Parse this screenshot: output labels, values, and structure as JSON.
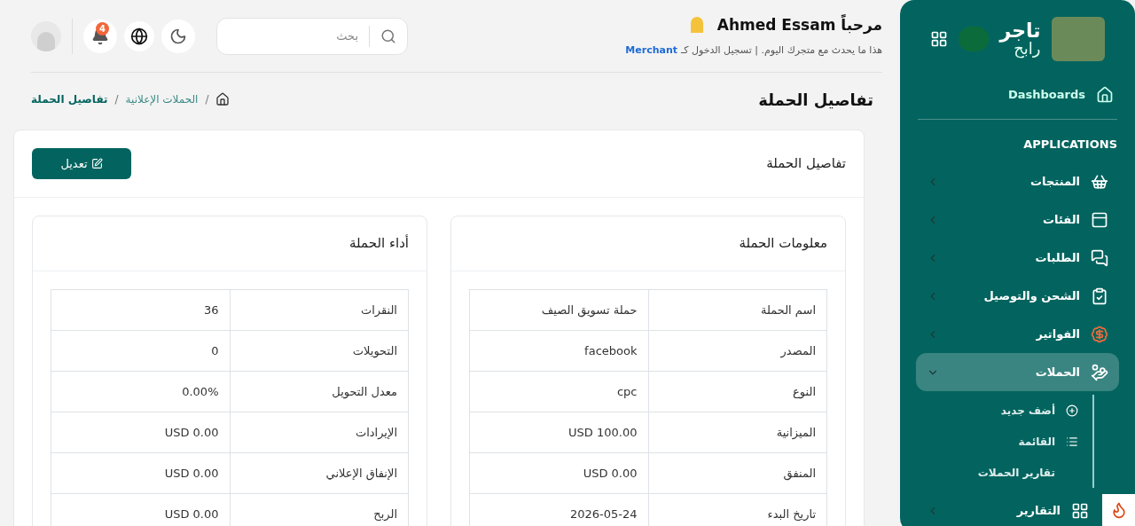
{
  "header": {
    "greeting": "مرحباً Ahmed Essam",
    "subtitle": "هذا ما يحدث مع متجرك اليوم. | تسجيل الدخول كـ",
    "role": "Merchant",
    "search": {
      "placeholder": "بحث"
    },
    "notifications": "4"
  },
  "page_title": "تفاصيل الحملة",
  "breadcrumb_separator": "/",
  "breadcrumb": [
    {
      "label": "الحملات الإعلانية",
      "current": false
    },
    {
      "label": "تفاصيل الحملة",
      "current": true
    }
  ],
  "card": {
    "title": "تفاصيل الحملة",
    "edit_button": "تعديل"
  },
  "info": {
    "title": "معلومات الحملة",
    "rows": [
      {
        "label": "اسم الحملة",
        "value": "حملة تسويق الصيف"
      },
      {
        "label": "المصدر",
        "value": "facebook"
      },
      {
        "label": "النوع",
        "value": "cpc"
      },
      {
        "label": "الميزانية",
        "value": "USD 100.00"
      },
      {
        "label": "المنفق",
        "value": "USD 0.00"
      },
      {
        "label": "تاريخ البدء",
        "value": "2026-05-24"
      }
    ]
  },
  "performance": {
    "title": "أداء الحملة",
    "rows": [
      {
        "label": "النقرات",
        "value": "36"
      },
      {
        "label": "التحويلات",
        "value": "0"
      },
      {
        "label": "معدل التحويل",
        "value": "0.00%"
      },
      {
        "label": "الإيرادات",
        "value": "USD 0.00"
      },
      {
        "label": "الإنفاق الإعلاني",
        "value": "USD 0.00"
      },
      {
        "label": "الربح",
        "value": "USD 0.00"
      }
    ]
  },
  "sidebar": {
    "logo": [
      "تاجر",
      "رابح"
    ],
    "dashboards": "Dashboards",
    "section": "APPLICATIONS",
    "items": [
      {
        "label": "المنتجات",
        "selected": false,
        "expanded": false
      },
      {
        "label": "الفئات",
        "selected": false,
        "expanded": false
      },
      {
        "label": "الطلبات",
        "selected": false,
        "expanded": false
      },
      {
        "label": "الشحن والتوصيل",
        "selected": false,
        "expanded": false
      },
      {
        "label": "الفواتير",
        "selected": false,
        "expanded": false
      },
      {
        "label": "الحملات",
        "selected": true,
        "expanded": true,
        "children": [
          {
            "label": "أضف جديد",
            "kind": "add"
          },
          {
            "label": "القائمة",
            "kind": "list"
          },
          {
            "label": "تقارير الحملات",
            "kind": "plain"
          }
        ]
      },
      {
        "label": "التقارير",
        "selected": false,
        "expanded": false
      }
    ]
  }
}
